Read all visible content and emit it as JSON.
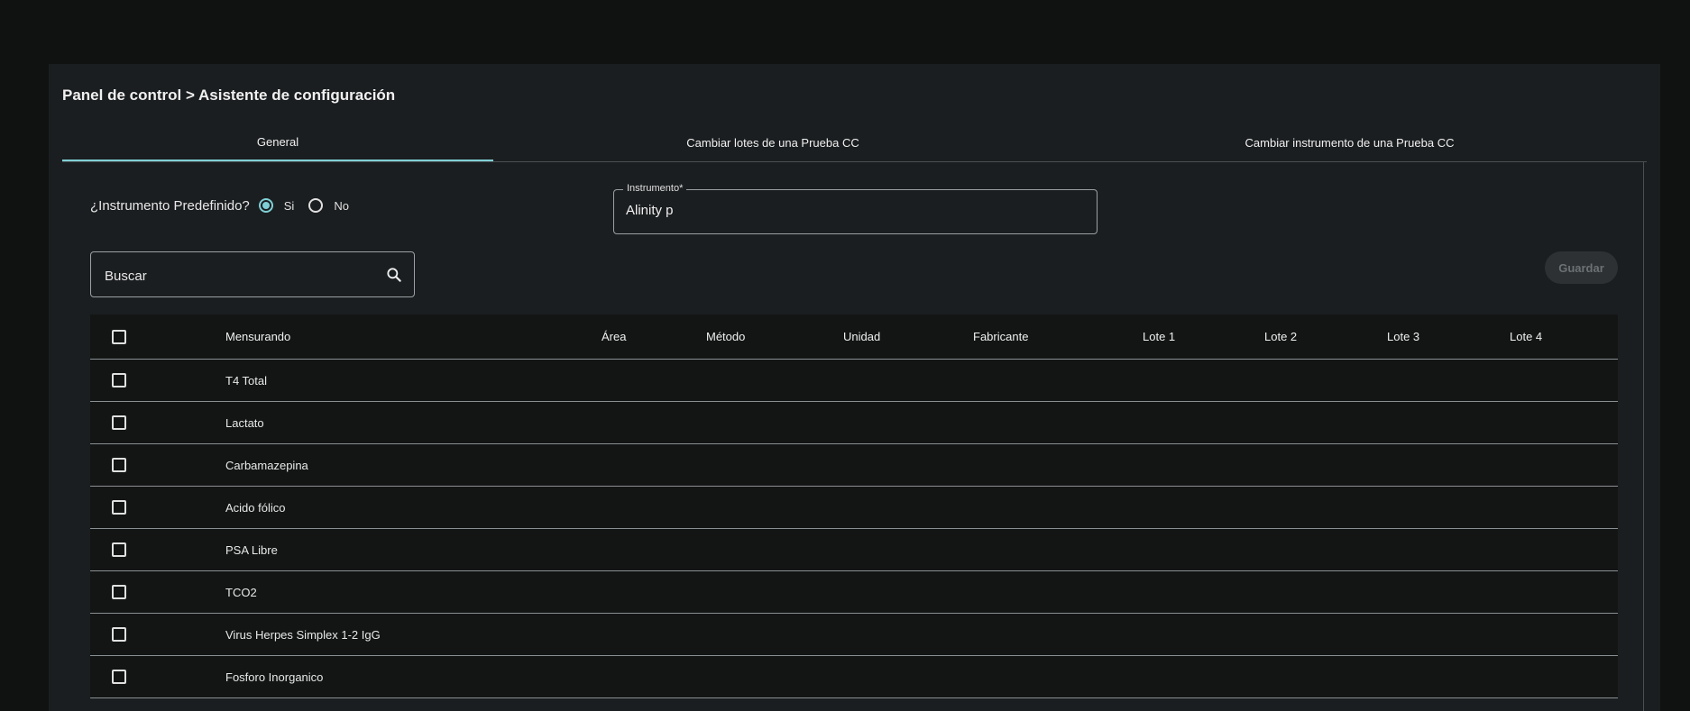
{
  "breadcrumb": "Panel de control > Asistente de configuración",
  "tabs": [
    {
      "label": "General"
    },
    {
      "label": "Cambiar lotes de una Prueba CC"
    },
    {
      "label": "Cambiar instrumento de una Prueba CC"
    }
  ],
  "predefined": {
    "question": "¿Instrumento Predefinido?",
    "yes_label": "Si",
    "no_label": "No",
    "selected": "Si"
  },
  "instrument": {
    "label": "Instrumento*",
    "value": "Alinity p"
  },
  "search": {
    "placeholder": "Buscar"
  },
  "save_label": "Guardar",
  "table": {
    "columns": [
      "Mensurando",
      "Área",
      "Método",
      "Unidad",
      "Fabricante",
      "Lote 1",
      "Lote 2",
      "Lote 3",
      "Lote 4"
    ],
    "rows": [
      {
        "mensurando": "T4 Total"
      },
      {
        "mensurando": "Lactato"
      },
      {
        "mensurando": "Carbamazepina"
      },
      {
        "mensurando": "Acido fólico"
      },
      {
        "mensurando": "PSA Libre"
      },
      {
        "mensurando": "TCO2"
      },
      {
        "mensurando": "Virus Herpes Simplex 1-2 IgG"
      },
      {
        "mensurando": "Fosforo Inorganico"
      }
    ]
  },
  "colors": {
    "accent": "#7fd0d6",
    "background": "#101212",
    "panel": "#1b1e20"
  },
  "icons": {
    "search": "search-icon"
  }
}
